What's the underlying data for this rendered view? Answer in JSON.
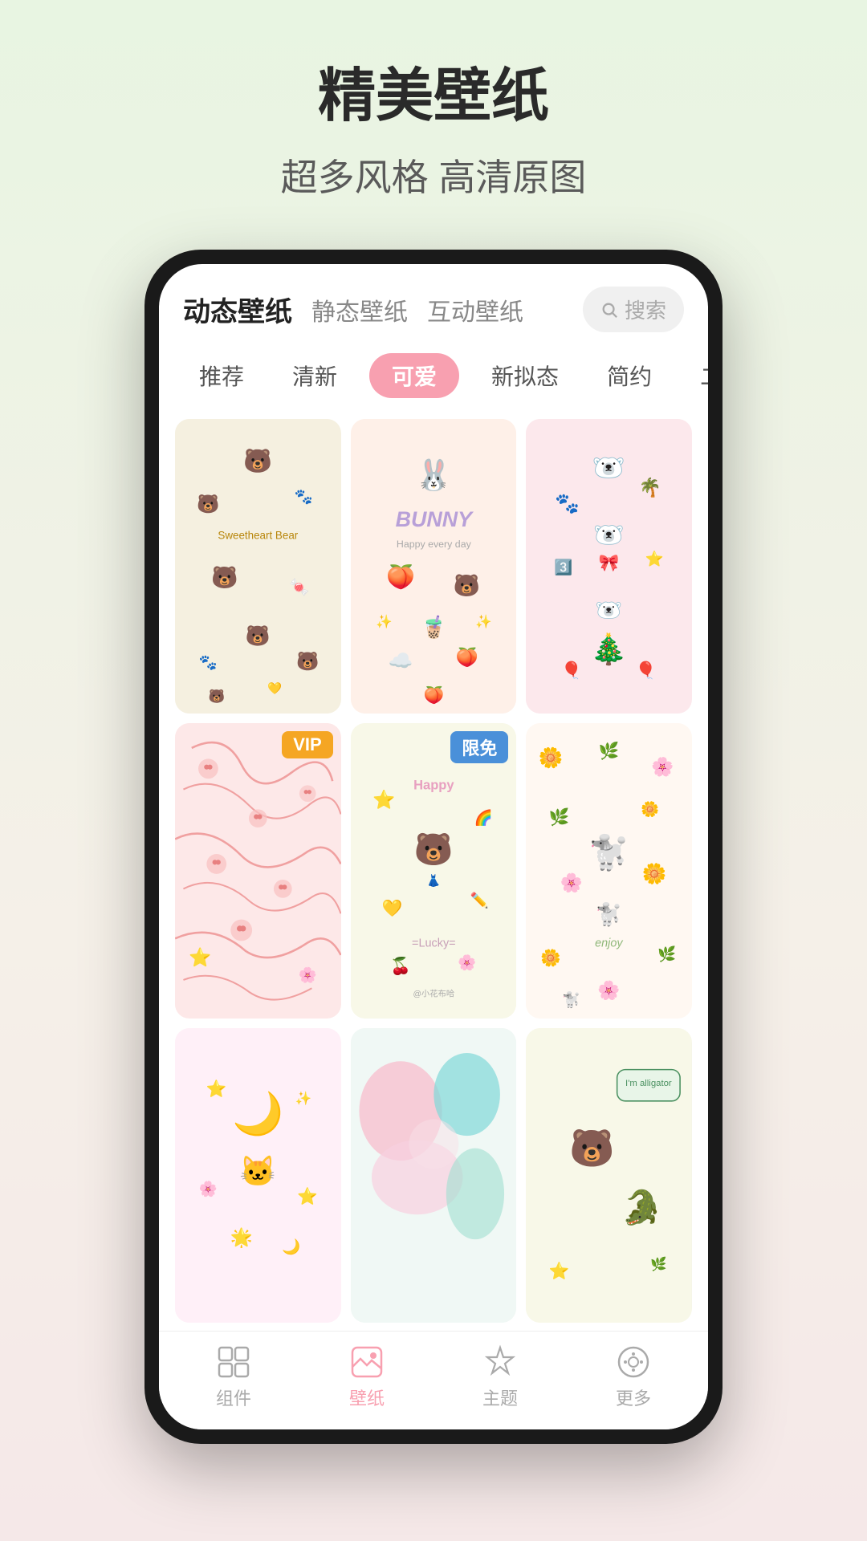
{
  "page": {
    "title": "精美壁纸",
    "subtitle": "超多风格 高清原图"
  },
  "nav_tabs": [
    {
      "label": "动态壁纸",
      "active": true
    },
    {
      "label": "静态壁纸",
      "active": false
    },
    {
      "label": "互动壁纸",
      "active": false
    }
  ],
  "search": {
    "placeholder": "搜索"
  },
  "categories": [
    {
      "label": "推荐",
      "active": false
    },
    {
      "label": "清新",
      "active": false
    },
    {
      "label": "可爱",
      "active": true
    },
    {
      "label": "新拟态",
      "active": false
    },
    {
      "label": "简约",
      "active": false
    },
    {
      "label": "二次元",
      "active": false
    }
  ],
  "wallpapers": [
    {
      "id": 1,
      "text": "Sweetheart Bear",
      "badge": null,
      "bg": "#f5f0e0",
      "theme": "bear-stickers"
    },
    {
      "id": 2,
      "text": "BUNNY",
      "badge": null,
      "bg": "#fef0e8",
      "theme": "bunny"
    },
    {
      "id": 3,
      "text": "",
      "badge": null,
      "bg": "#fce8ec",
      "theme": "white-bears"
    },
    {
      "id": 4,
      "text": "",
      "badge": "VIP",
      "bg": "#fde8e8",
      "theme": "pink-pattern"
    },
    {
      "id": 5,
      "text": "Happy\n=Lucky=",
      "badge": "限免",
      "bg": "#f5f8e8",
      "theme": "happy-bear"
    },
    {
      "id": 6,
      "text": "enjoy",
      "badge": null,
      "bg": "#fff8f0",
      "theme": "flowers-dog"
    },
    {
      "id": 7,
      "text": "",
      "badge": null,
      "bg": "#fff0f5",
      "theme": "cat-moon"
    },
    {
      "id": 8,
      "text": "",
      "badge": null,
      "bg": "#f0f5f0",
      "theme": "abstract"
    },
    {
      "id": 9,
      "text": "I'm alligator",
      "badge": null,
      "bg": "#f5f5e8",
      "theme": "bear-alligator"
    }
  ],
  "bottom_nav": [
    {
      "label": "组件",
      "icon": "widget",
      "active": false
    },
    {
      "label": "壁纸",
      "icon": "wallpaper",
      "active": true
    },
    {
      "label": "主题",
      "icon": "star",
      "active": false
    },
    {
      "label": "更多",
      "icon": "more",
      "active": false
    }
  ]
}
